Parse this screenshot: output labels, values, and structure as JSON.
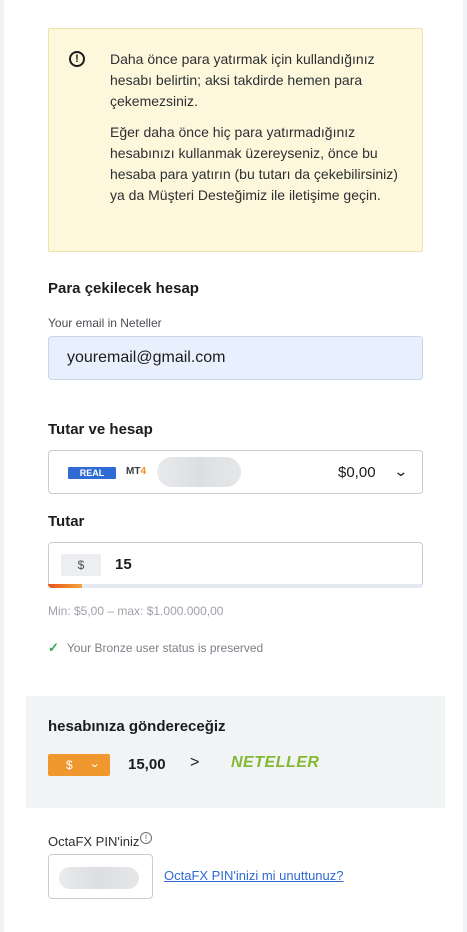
{
  "warning": {
    "icon": "exclamation-circle-icon",
    "paragraph1": "Daha önce para yatırmak için kullandığınız hesabı belirtin; aksi takdirde hemen para çekemezsiniz.",
    "paragraph2": "Eğer daha önce hiç para yatırmadığınız hesabınızı kullanmak üzereyseniz, önce bu hesaba para yatırın (bu tutarı da çekebilirsiniz) ya da Müşteri Desteğimiz ile iletişime geçin."
  },
  "withdraw_account": {
    "heading": "Para çekilecek hesap",
    "email_label": "Your email in Neteller",
    "email_value": "youremail@gmail.com"
  },
  "amount_account": {
    "heading": "Tutar ve hesap",
    "badge": "REAL",
    "platform_prefix": "MT",
    "platform_suffix": "4",
    "balance": "$0,00"
  },
  "amount": {
    "heading": "Tutar",
    "currency_symbol": "$",
    "value": "15",
    "progress_fraction": 0.09,
    "limits": "Min: $5,00 – max: $1.000.000,00",
    "status": "Your Bronze user status is preserved"
  },
  "send": {
    "title": "hesabınıza göndereceğiz",
    "currency_symbol": "$",
    "amount": "15,00",
    "arrow": ">",
    "brand": "NETELLER"
  },
  "pin": {
    "label": "OctaFX PIN'iniz",
    "info_symbol": "!",
    "forgot_link": "OctaFX PIN'inizi mi unuttunuz?"
  },
  "colors": {
    "accent_blue": "#2f6bd2",
    "warning_bg": "#fdf7dc",
    "orange": "#f0982e",
    "neteller_green": "#83b932",
    "success_green": "#2faa54"
  }
}
